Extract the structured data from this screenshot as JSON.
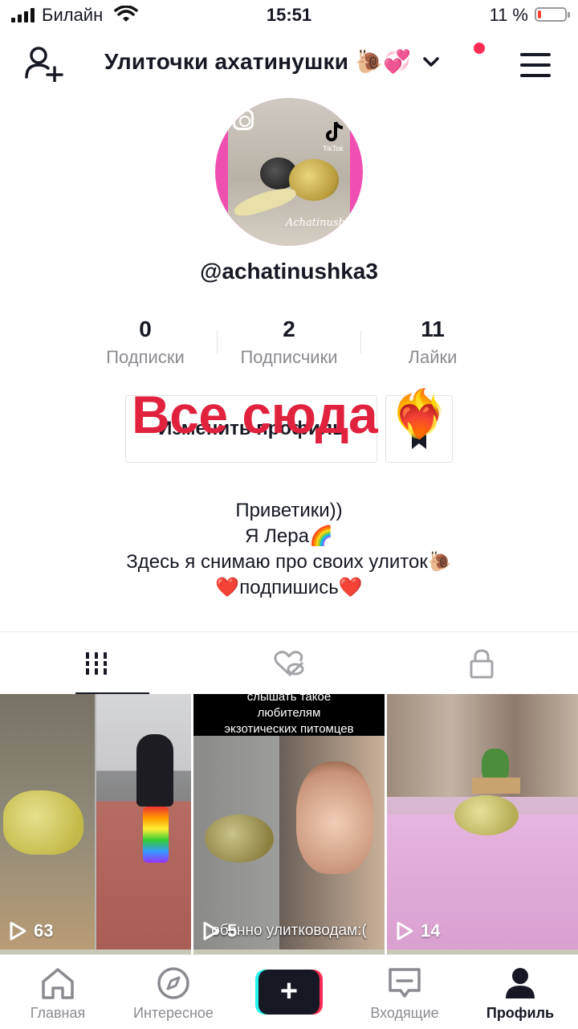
{
  "status_bar": {
    "carrier": "Билайн",
    "time": "15:51",
    "battery_percent": "11 %",
    "battery_level": 0.11,
    "battery_color": "#ff3b30"
  },
  "header": {
    "title": "Улиточки ахатинушки",
    "title_emoji": "🐌💞",
    "notification_dot_color": "#fe2c55"
  },
  "profile": {
    "username": "@achatinushka3",
    "avatar_brand_text": "TikTok",
    "avatar_signature": "Achatinushka",
    "stats": [
      {
        "value": "0",
        "label": "Подписки"
      },
      {
        "value": "2",
        "label": "Подписчики"
      },
      {
        "value": "11",
        "label": "Лайки"
      }
    ],
    "edit_button_label": "Изменить профиль",
    "overlay_text": "Все сюда",
    "overlay_emoji": "❤️‍🔥",
    "bio_lines": [
      "Приветики))",
      "Я Лера🌈",
      "Здесь я снимаю про своих улиток🐌",
      "❤️подпишись❤️"
    ]
  },
  "tabs": [
    {
      "icon": "grid-icon",
      "active": true
    },
    {
      "icon": "liked-hidden-icon",
      "active": false
    },
    {
      "icon": "lock-icon",
      "active": false
    }
  ],
  "videos": [
    {
      "views": "63"
    },
    {
      "views": "5",
      "caption_top": "слышать такое",
      "caption_mid": "любителям",
      "caption_bottom": "экзотических питомцев",
      "overlay_caption": "обенно улитководам:("
    },
    {
      "views": "14"
    }
  ],
  "nav": {
    "home": "Главная",
    "discover": "Интересное",
    "create": "+",
    "inbox": "Входящие",
    "profile": "Профиль"
  },
  "colors": {
    "accent": "#fe2c55",
    "accent_alt": "#25f4ee",
    "text_primary": "#161823",
    "text_secondary": "#8a8b91",
    "overlay_red": "#e1223e"
  }
}
